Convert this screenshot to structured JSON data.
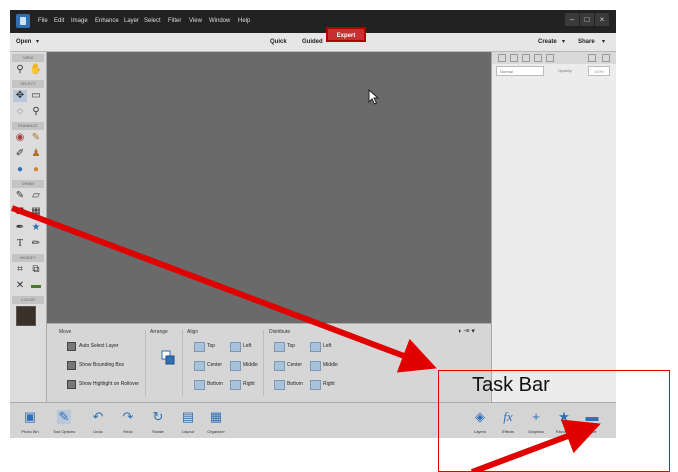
{
  "menu": {
    "items": [
      "File",
      "Edit",
      "Image",
      "Enhance",
      "Layer",
      "Select",
      "Filter",
      "View",
      "Window",
      "Help"
    ],
    "window_buttons": [
      "–",
      "□",
      "×"
    ]
  },
  "modebar": {
    "open_label": "Open",
    "modes": [
      "Quick",
      "Guided",
      "Expert"
    ],
    "active_mode": "Expert",
    "create_label": "Create",
    "share_label": "Share"
  },
  "toolbar": {
    "sections": [
      "VIEW",
      "SELECT",
      "ENHANCE",
      "DRAW",
      "MODIFY",
      "COLOR"
    ]
  },
  "layers_panel": {
    "blend_mode": "Normal",
    "opacity_label": "Opacity:",
    "opacity_value": "100%"
  },
  "tool_options": {
    "move_header": "Move",
    "arrange_header": "Arrange",
    "align_header": "Align",
    "distribute_header": "Distribute",
    "checkboxes": [
      "Auto Select Layer",
      "Show Bounding Box",
      "Show Highlight on Rollover"
    ],
    "align_labels": [
      "Top",
      "Left",
      "Center",
      "Middle",
      "Bottom",
      "Right"
    ],
    "distribute_labels": [
      "Top",
      "Left",
      "Center",
      "Middle",
      "Bottom",
      "Right"
    ]
  },
  "taskbar": {
    "left_items": [
      "Photo Bin",
      "Tool Options",
      "Undo",
      "Redo",
      "Rotate",
      "Layout",
      "Organizer"
    ],
    "right_items": [
      "Layers",
      "Effects",
      "Graphics",
      "Favorites",
      "More"
    ]
  },
  "annotation": {
    "label": "Task Bar",
    "color": "#e00000"
  }
}
